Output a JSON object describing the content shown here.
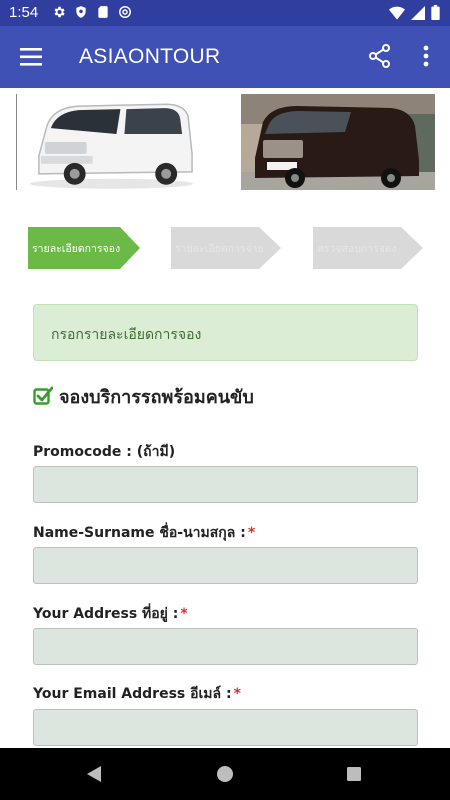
{
  "status_bar": {
    "time": "1:54",
    "icons": [
      "gear-icon",
      "shield-icon",
      "sd-card-icon",
      "at-sign-icon",
      "wifi-icon",
      "signal-icon",
      "battery-icon"
    ]
  },
  "app_bar": {
    "title": "ASIAONTOUR",
    "color": "#3f51b5",
    "status_color": "#303f9f"
  },
  "banner": {
    "images": [
      "white-van-photo",
      "black-van-photo"
    ]
  },
  "steps": [
    {
      "label": "รายละเอียดการจอง",
      "active": true,
      "color": "#6aba45"
    },
    {
      "label": "รายละเอียดการจ่าย",
      "active": false,
      "color": "#d9d9d9"
    },
    {
      "label": "ตรวจสอบการจอง",
      "active": false,
      "color": "#d9d9d9"
    }
  ],
  "alert": {
    "text": "กรอกรายละเอียดการจอง"
  },
  "section": {
    "title": "จองบริการรถพร้อมคนขับ",
    "checked": true
  },
  "form": {
    "promocode": {
      "label": "Promocode : (ถ้ามี)",
      "value": ""
    },
    "name": {
      "label": "Name-Surname ชื่อ-นามสกุล :",
      "required_mark": "*",
      "value": ""
    },
    "address": {
      "label": "Your Address ที่อยู่ :",
      "required_mark": "*",
      "value": ""
    },
    "email": {
      "label": "Your Email Address อีเมล์ :",
      "required_mark": "*",
      "value": ""
    }
  },
  "nav": {
    "buttons": [
      "back-icon",
      "home-icon",
      "recents-icon"
    ]
  }
}
